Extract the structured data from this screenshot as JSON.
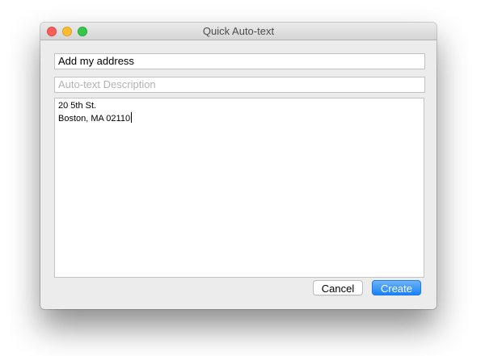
{
  "window": {
    "title": "Quick Auto-text"
  },
  "form": {
    "name_value": "Add my address",
    "description_placeholder": "Auto-text Description",
    "body_lines": [
      "20 5th St.",
      "Boston, MA 02110"
    ]
  },
  "buttons": {
    "cancel_label": "Cancel",
    "create_label": "Create"
  },
  "icons": {
    "close": "close-icon",
    "minimize": "minimize-icon",
    "zoom": "zoom-icon"
  },
  "colors": {
    "accent": "#1a82fb",
    "close": "#fc5f57",
    "minimize": "#fdbc2e",
    "zoom": "#34c84a"
  }
}
